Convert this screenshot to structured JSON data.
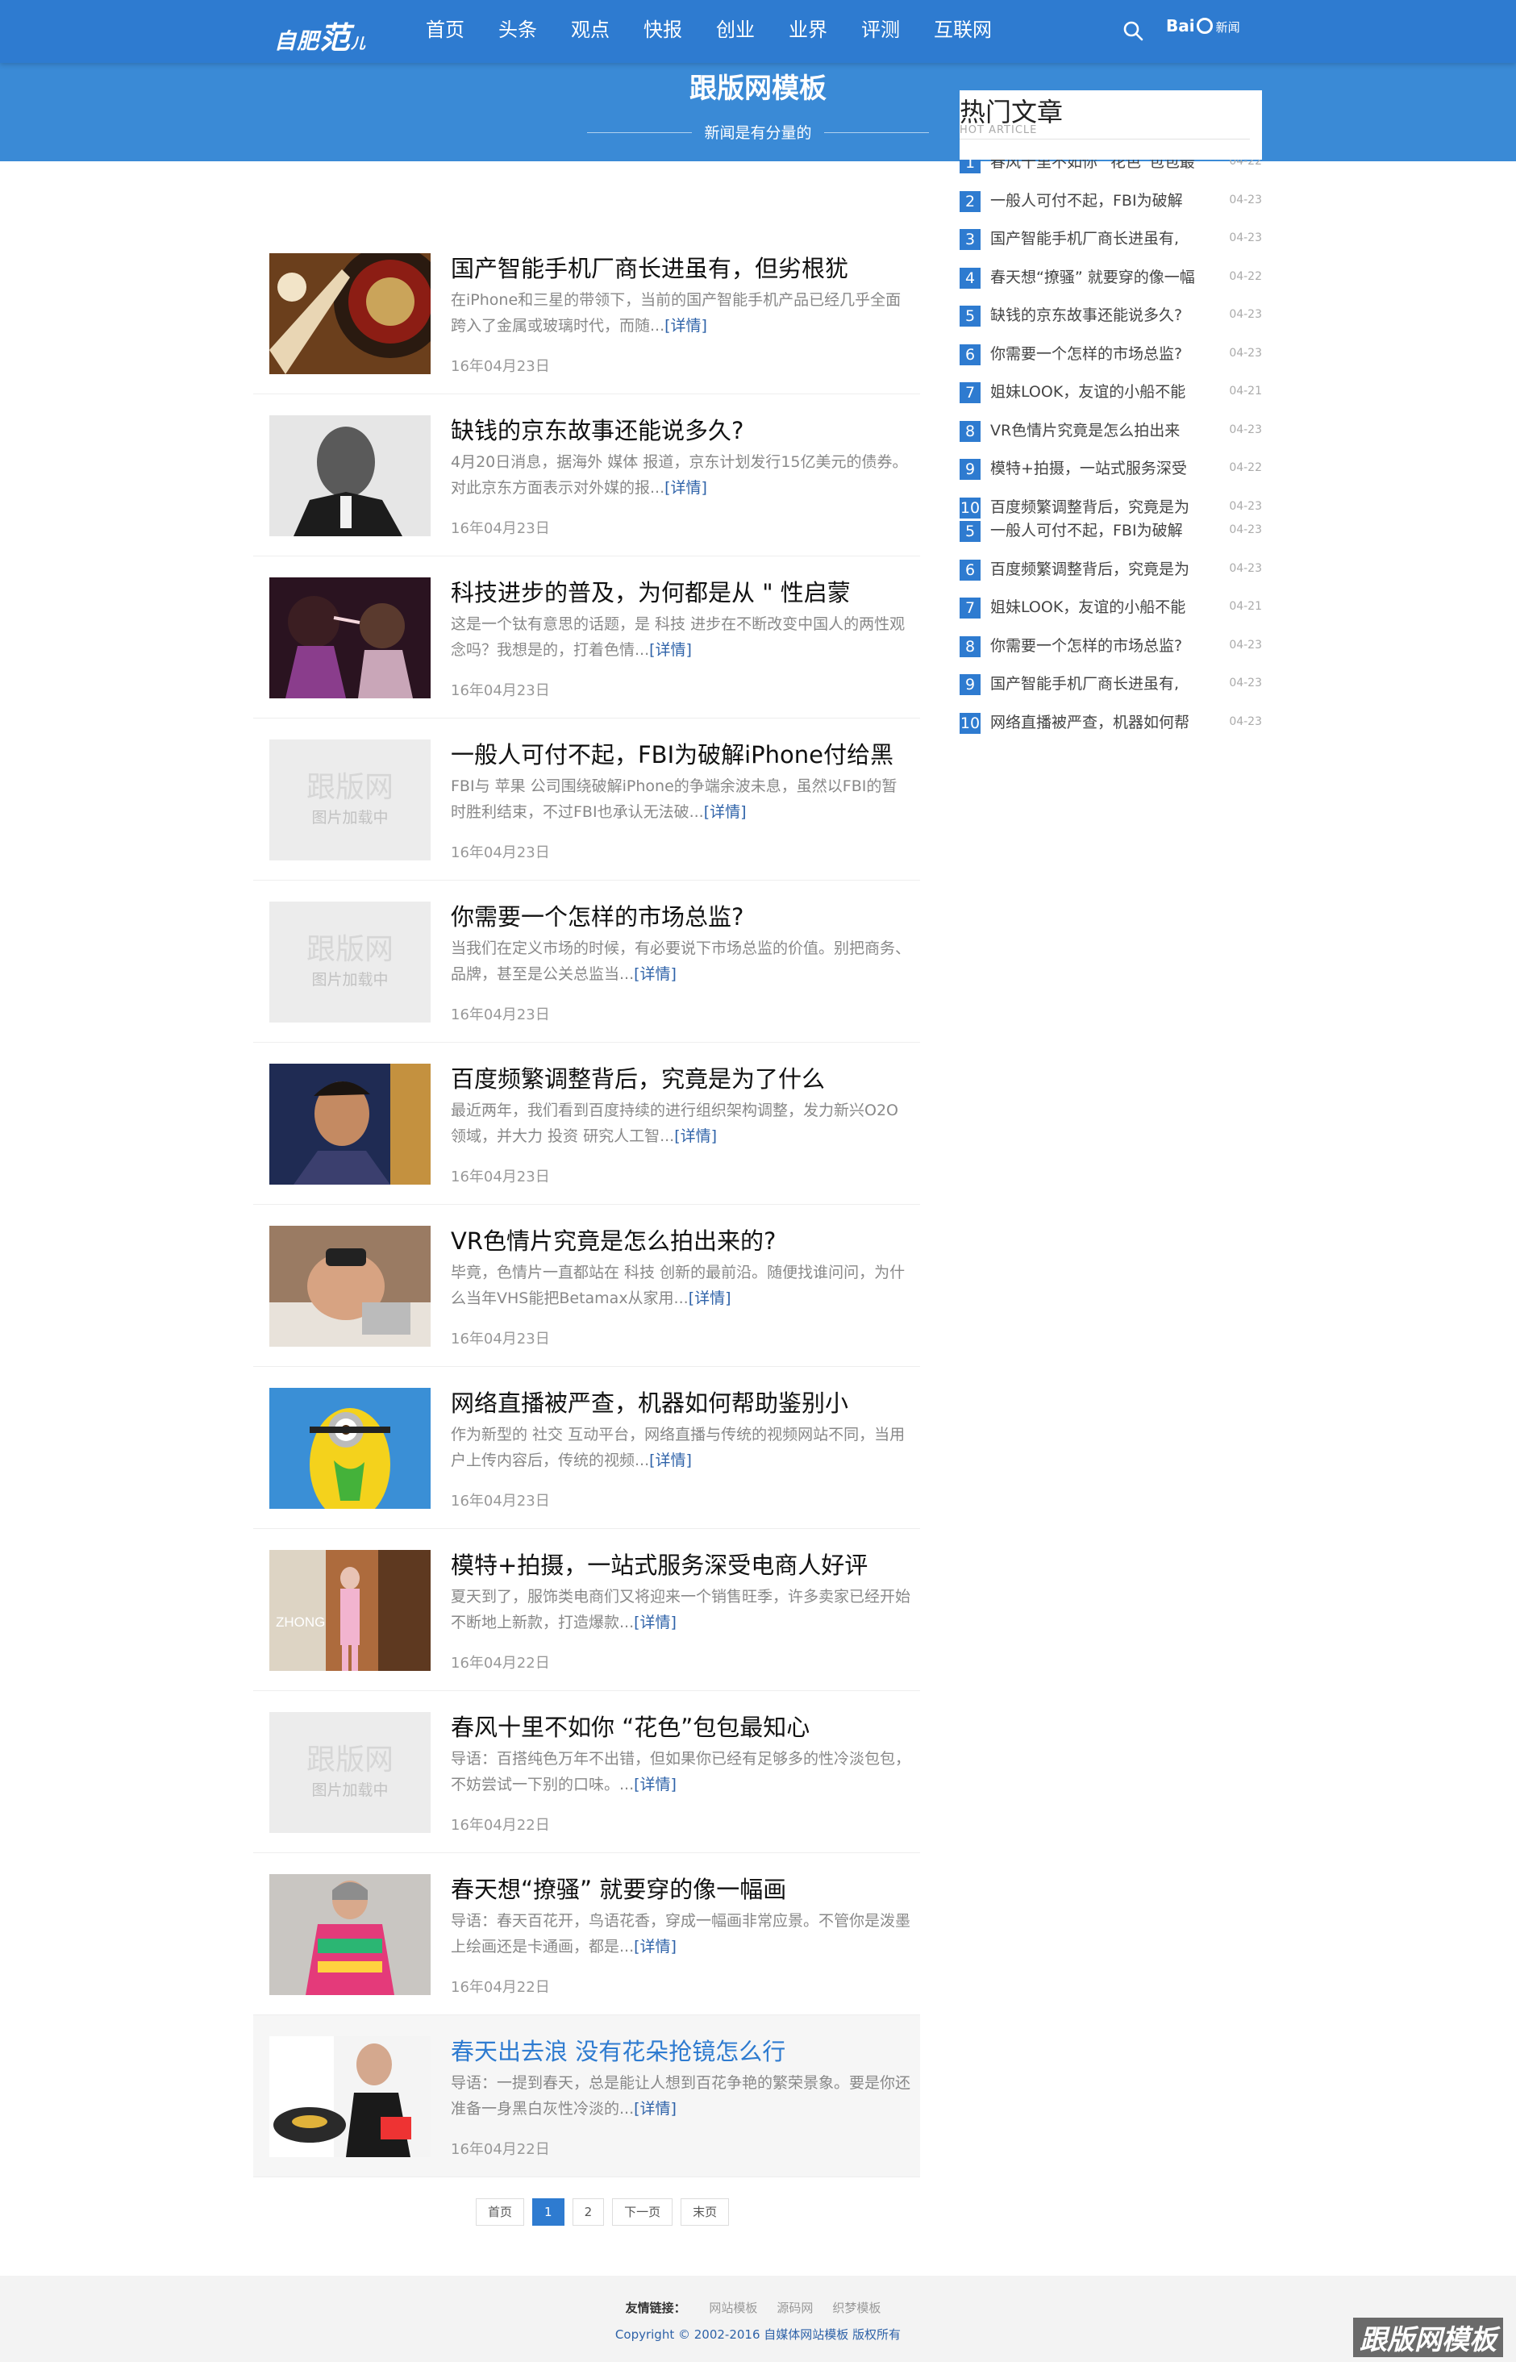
{
  "header": {
    "logo_small": "自肥",
    "logo_big": "范",
    "logo_tail": "儿",
    "nav": [
      {
        "label": "首页"
      },
      {
        "label": "头条"
      },
      {
        "label": "观点"
      },
      {
        "label": "快报"
      },
      {
        "label": "创业"
      },
      {
        "label": "业界"
      },
      {
        "label": "评测"
      },
      {
        "label": "互联网"
      }
    ],
    "baidu_a": "Bai",
    "baidu_b": "新闻"
  },
  "banner": {
    "title": "跟版网模板",
    "tagline": "新闻是有分量的"
  },
  "articles": [
    {
      "title": "国产智能手机厂商长进虽有，但劣根犹",
      "summary": "在iPhone和三星的带领下，当前的国产智能手机产品已经几乎全面跨入了金属或玻璃时代，而随...",
      "more": "[详情]",
      "date": "16年04月23日",
      "thumb": "roulette"
    },
    {
      "title": "缺钱的京东故事还能说多久?",
      "summary": "4月20日消息，据海外 媒体 报道，京东计划发行15亿美元的债券。对此京东方面表示对外媒的报...",
      "more": "[详情]",
      "date": "16年04月23日",
      "thumb": "man"
    },
    {
      "title": "科技进步的普及，为何都是从 \" 性启蒙",
      "summary": "这是一个钛有意思的话题，是 科技 进步在不断改变中国人的两性观念吗？我想是的，打着色情...",
      "more": "[详情]",
      "date": "16年04月23日",
      "thumb": "women"
    },
    {
      "title": "一般人可付不起，FBI为破解iPhone付给黑",
      "summary": "FBI与 苹果 公司围绕破解iPhone的争端余波未息，虽然以FBI的暂时胜利结束，不过FBI也承认无法破...",
      "more": "[详情]",
      "date": "16年04月23日",
      "thumb": "placeholder"
    },
    {
      "title": "你需要一个怎样的市场总监?",
      "summary": "当我们在定义市场的时候，有必要说下市场总监的价值。别把商务、品牌，甚至是公关总监当...",
      "more": "[详情]",
      "date": "16年04月23日",
      "thumb": "placeholder"
    },
    {
      "title": "百度频繁调整背后，究竟是为了什么",
      "summary": "最近两年，我们看到百度持续的进行组织架构调整，发力新兴O2O领域，并大力 投资 研究人工智...",
      "more": "[详情]",
      "date": "16年04月23日",
      "thumb": "boy"
    },
    {
      "title": "VR色情片究竟是怎么拍出来的?",
      "summary": "毕竟，色情片一直都站在 科技 创新的最前沿。随便找谁问问，为什么当年VHS能把Betamax从家用...",
      "more": "[详情]",
      "date": "16年04月23日",
      "thumb": "vr"
    },
    {
      "title": "网络直播被严查，机器如何帮助鉴别小",
      "summary": "作为新型的 社交 互动平台，网络直播与传统的视频网站不同，当用户上传内容后，传统的视频...",
      "more": "[详情]",
      "date": "16年04月23日",
      "thumb": "minion"
    },
    {
      "title": "模特+拍摄，一站式服务深受电商人好评",
      "summary": "夏天到了，服饰类电商们又将迎来一个销售旺季，许多卖家已经开始不断地上新款，打造爆款...",
      "more": "[详情]",
      "date": "16年04月22日",
      "thumb": "model"
    },
    {
      "title": "春风十里不如你 “花色”包包最知心",
      "summary": "导语：百搭纯色万年不出错，但如果你已经有足够多的性冷淡包包，不妨尝试一下别的口味。...",
      "more": "[详情]",
      "date": "16年04月22日",
      "thumb": "placeholder"
    },
    {
      "title": "春天想“撩骚” 就要穿的像一幅画",
      "summary": "导语：春天百花开，鸟语花香，穿成一幅画非常应景。不管你是泼墨上绘画还是卡通画，都是...",
      "more": "[详情]",
      "date": "16年04月22日",
      "thumb": "fashion"
    },
    {
      "title": "春天出去浪 没有花朵抢镜怎么行",
      "summary": "导语：一提到春天，总是能让人想到百花争艳的繁荣景象。要是你还准备一身黑白灰性冷淡的...",
      "more": "[详情]",
      "date": "16年04月22日",
      "thumb": "spring"
    }
  ],
  "placeholder": {
    "top": "跟版网",
    "bottom": "图片加载中"
  },
  "pagination": [
    "首页",
    "1",
    "2",
    "下一页",
    "末页"
  ],
  "sidebar": {
    "title": "热门文章",
    "subtitle": "HOT ARTICLE",
    "list_a": [
      {
        "num": "1",
        "text": "春风十里不如你 “花色”包包最",
        "date": "04-22"
      },
      {
        "num": "2",
        "text": "一般人可付不起，FBI为破解",
        "date": "04-23"
      },
      {
        "num": "3",
        "text": "国产智能手机厂商长进虽有,",
        "date": "04-23"
      },
      {
        "num": "4",
        "text": "春天想“撩骚” 就要穿的像一幅",
        "date": "04-22"
      },
      {
        "num": "5",
        "text": "缺钱的京东故事还能说多久?",
        "date": "04-23"
      },
      {
        "num": "6",
        "text": "你需要一个怎样的市场总监?",
        "date": "04-23"
      },
      {
        "num": "7",
        "text": "姐妹LOOK，友谊的小船不能",
        "date": "04-21"
      },
      {
        "num": "8",
        "text": "VR色情片究竟是怎么拍出来",
        "date": "04-23"
      },
      {
        "num": "9",
        "text": "模特+拍摄，一站式服务深受",
        "date": "04-22"
      },
      {
        "num": "10",
        "text": "百度频繁调整背后，究竟是为",
        "date": "04-23"
      }
    ],
    "list_b": [
      {
        "num": "5",
        "text": "一般人可付不起，FBI为破解",
        "date": "04-23"
      },
      {
        "num": "6",
        "text": "百度频繁调整背后，究竟是为",
        "date": "04-23"
      },
      {
        "num": "7",
        "text": "姐妹LOOK，友谊的小船不能",
        "date": "04-21"
      },
      {
        "num": "8",
        "text": "你需要一个怎样的市场总监?",
        "date": "04-23"
      },
      {
        "num": "9",
        "text": "国产智能手机厂商长进虽有,",
        "date": "04-23"
      },
      {
        "num": "10",
        "text": "网络直播被严查，机器如何帮",
        "date": "04-23"
      }
    ]
  },
  "footer": {
    "links_label": "友情链接：",
    "links": [
      "网站模板",
      "源码网",
      "织梦模板"
    ],
    "copyright": "Copyright © 2002-2016 自媒体网站模板 版权所有",
    "watermark": "跟版网模板"
  },
  "colors": {
    "brand": "#2e7bd0",
    "link": "#2e62a8"
  }
}
